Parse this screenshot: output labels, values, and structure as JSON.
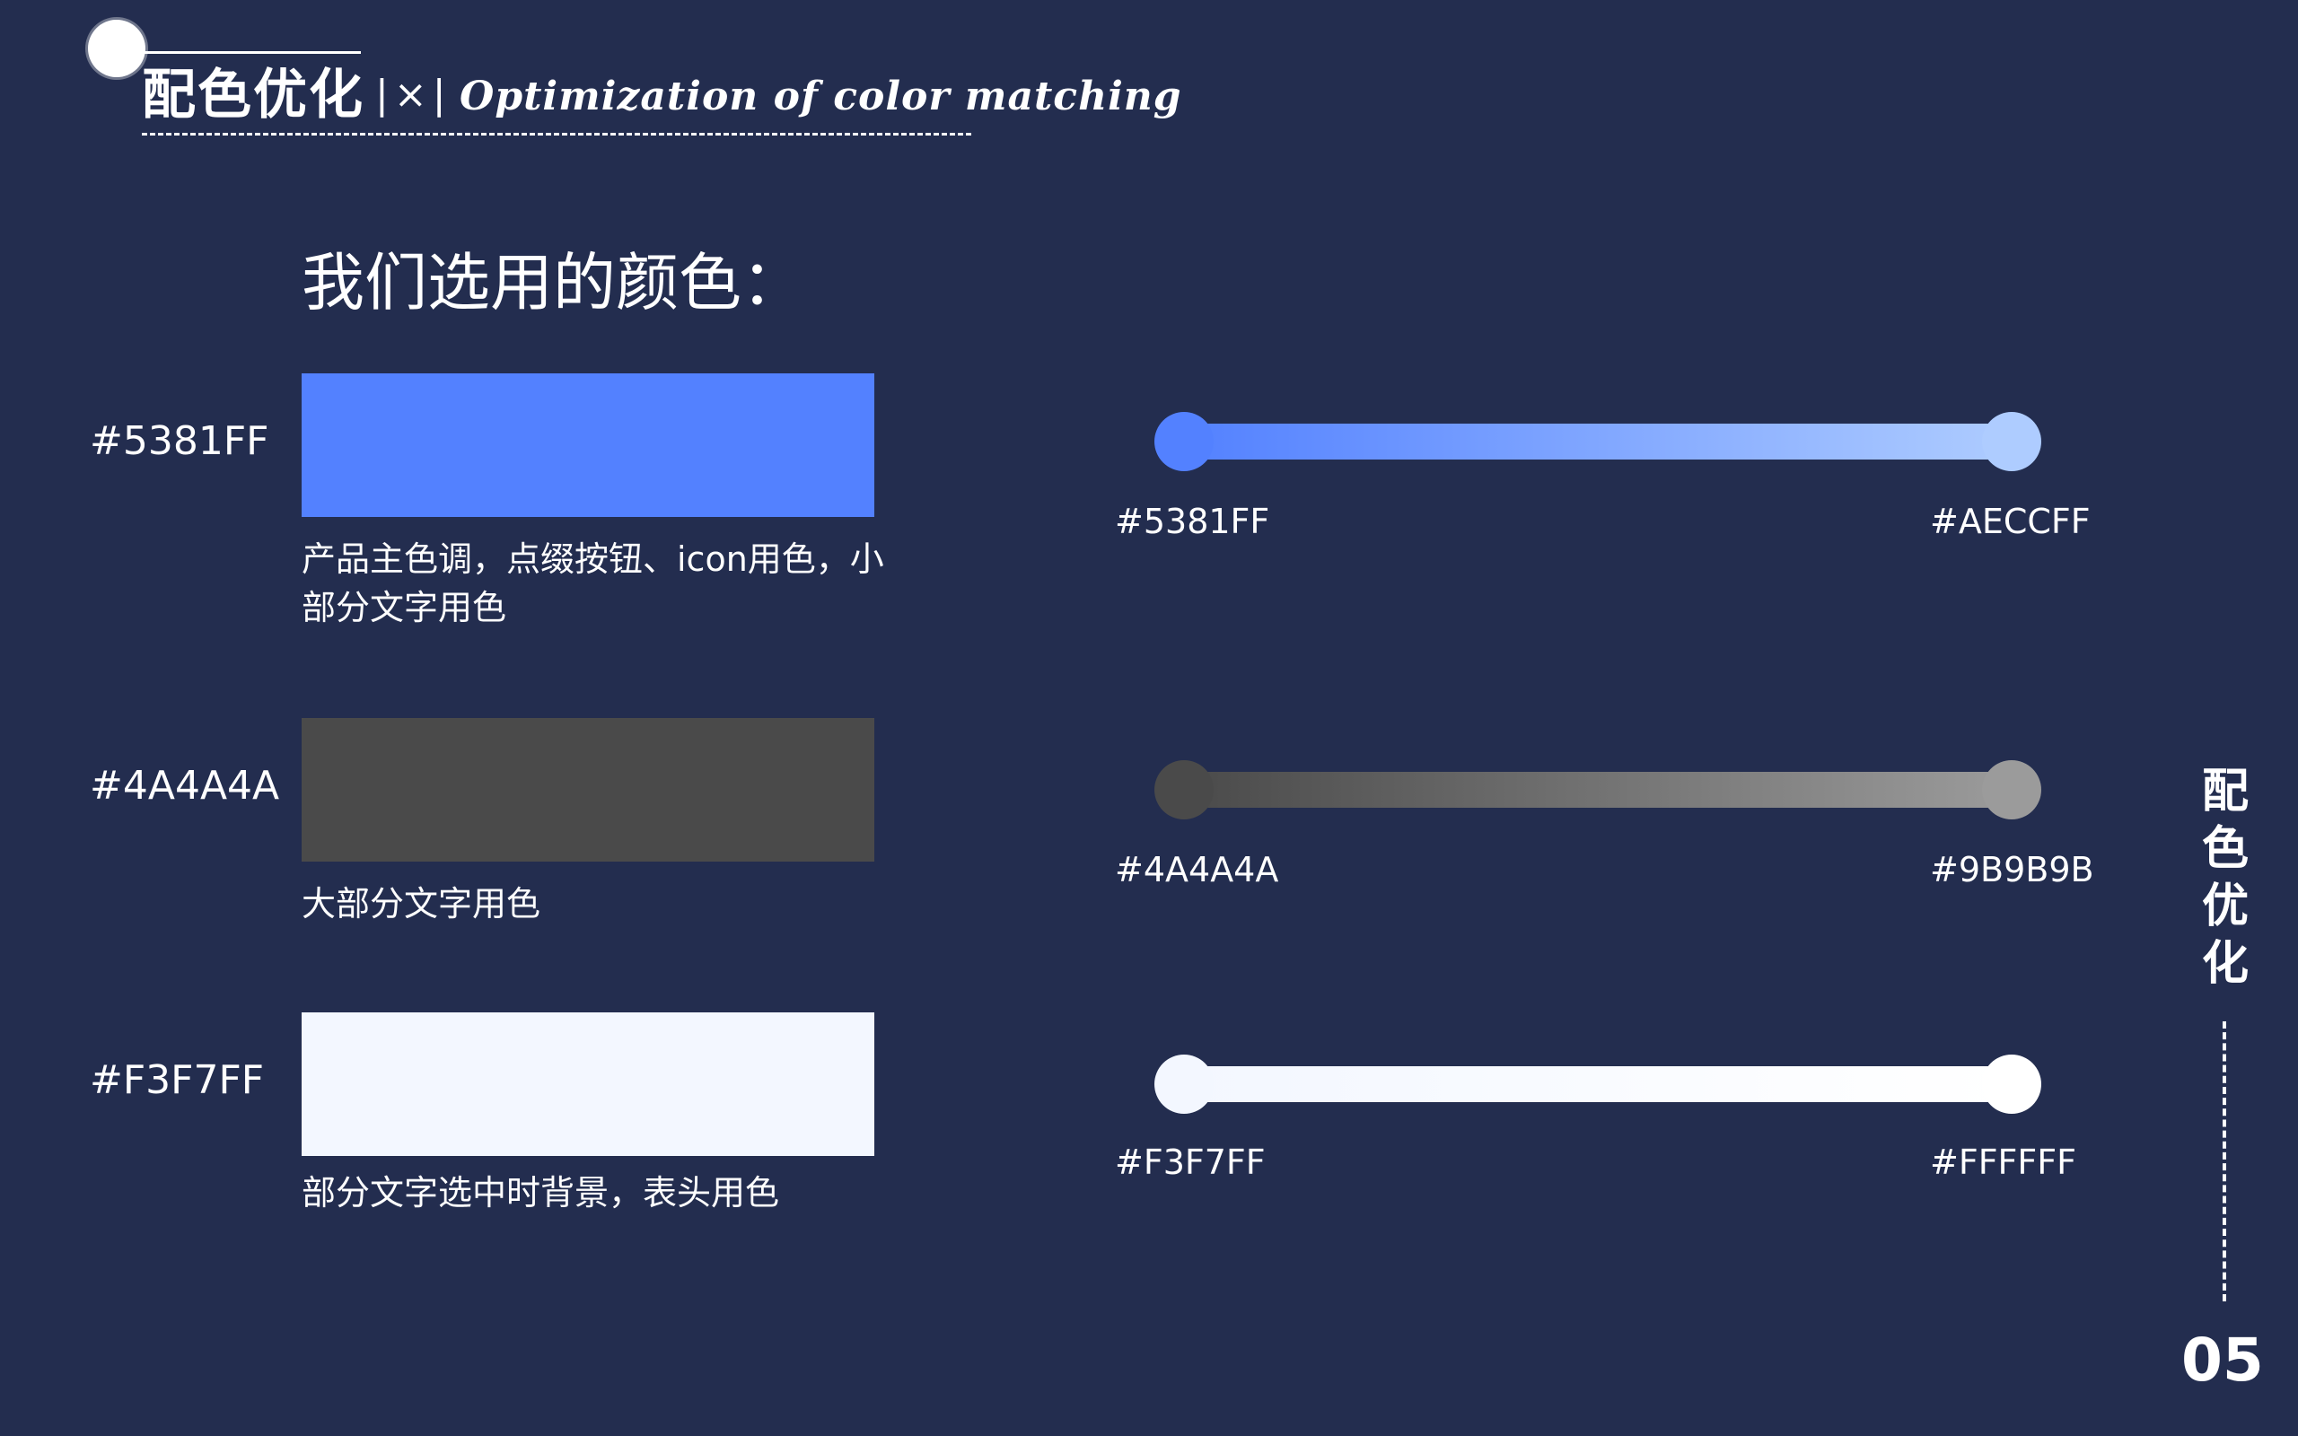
{
  "header": {
    "title_cn": "配色优化",
    "separator": "|×|",
    "title_en": "Optimization of color matching"
  },
  "section": {
    "heading": "我们选用的颜色："
  },
  "swatches": [
    {
      "hex": "#5381FF",
      "color": "#5381FF",
      "description": "产品主色调，点缀按钮、icon用色，小部分文字用色"
    },
    {
      "hex": "#4A4A4A",
      "color": "#4A4A4A",
      "description": "大部分文字用色"
    },
    {
      "hex": "#F3F7FF",
      "color": "#F3F7FF",
      "description": "部分文字选中时背景，表头用色"
    }
  ],
  "gradients": [
    {
      "start_label": "#5381FF",
      "end_label": "#AECCFF",
      "start_color": "#5381FF",
      "end_color": "#AECCFF"
    },
    {
      "start_label": "#4A4A4A",
      "end_label": "#9B9B9B",
      "start_color": "#4A4A4A",
      "end_color": "#9B9B9B"
    },
    {
      "start_label": "#F3F7FF",
      "end_label": "#FFFFFF",
      "start_color": "#F3F7FF",
      "end_color": "#FFFFFF"
    }
  ],
  "side": {
    "title": "配色优化",
    "page_number": "05"
  },
  "theme": {
    "background": "#232D4F",
    "text": "#FFFFFF"
  }
}
